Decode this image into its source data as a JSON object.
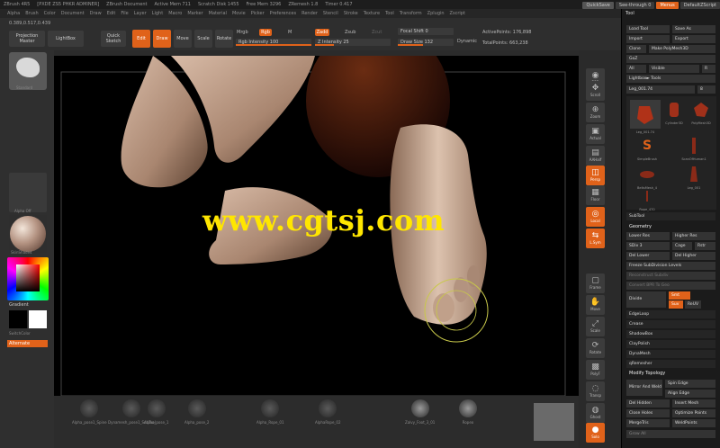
{
  "app": {
    "title_items": [
      "ZBrush 4R5",
      "[PXDE ZS5 PHKR ADMINER]",
      "ZBrush Document",
      "Active Mem 711",
      "Scratch Disk 1455",
      "Free Mem 3296",
      "ZRemesh 1.8",
      "Timer 0.417"
    ],
    "quicksave": "QuickSave",
    "see_through": "See-through",
    "see_through_value": "0",
    "menus_label": "Menus",
    "default_script": "DefaultZScript"
  },
  "menubar": {
    "items": [
      "Alpha",
      "Brush",
      "Color",
      "Document",
      "Draw",
      "Edit",
      "File",
      "Layer",
      "Light",
      "Macro",
      "Marker",
      "Material",
      "Movie",
      "Picker",
      "Preferences",
      "Render",
      "Stencil",
      "Stroke",
      "Texture",
      "Tool",
      "Transform",
      "Zplugin",
      "Zscript"
    ]
  },
  "toolbar": {
    "coords": "0.389,0.517,0.439",
    "projection_master": "Projection Master",
    "lightbox": "LightBox",
    "quick_sketch": "Quick Sketch",
    "edit": "Edit",
    "draw": "Draw",
    "move": "Move",
    "scale": "Scale",
    "rotate": "Rotate",
    "mrgb": "Mrgb",
    "rgb": "Rgb",
    "m": "M",
    "zadd": "Zadd",
    "zsub": "Zsub",
    "zcut": "Zcut",
    "rgb_intensity": "Rgb Intensity 100",
    "z_intensity": "Z Intensity 25",
    "focal_shift": "Focal Shift 0",
    "draw_size": "Draw Size 132",
    "dynamic": "Dynamic",
    "active_points": "ActivePoints: 176,898",
    "total_points": "TotalPoints: 663,238",
    "rgb_intensity_fill": 1.0,
    "z_intensity_fill": 0.25,
    "draw_size_fill": 0.45
  },
  "leftpanel": {
    "brush_label": "Standard",
    "alpha_label": "Alpha Off",
    "material_label": "SkinShade4",
    "gradient_label": "Gradient",
    "switch_color": "SwitchColor",
    "alternate": "Alternate"
  },
  "shelf": {
    "items": [
      "Alpha_pose1_Spine",
      "Dynamesh_pose1_SubTool",
      "Alpha_pose_1",
      "Alpha_pose_2",
      "Alpha_Rope_01",
      "AlphaRope_02",
      "Zalvy_Foot_3_01",
      "Ropeo"
    ]
  },
  "rightshelf": {
    "buttons": [
      "BPR",
      "Scroll",
      "Zoom",
      "Actual",
      "AAHalf",
      "Persp",
      "Floor",
      "Local",
      "L.Sym",
      "Frame",
      "Move",
      "Scale",
      "Rotate",
      "PolyF",
      "Transp",
      "Ghost",
      "Solo",
      "Xpose"
    ]
  },
  "toolpanel": {
    "title": "Tool",
    "load_tool": "Load Tool",
    "save_as": "Save As",
    "import": "Import",
    "export": "Export",
    "clone": "Clone",
    "make_polymesh": "Make PolyMesh3D",
    "goz": "GoZ",
    "all": "All",
    "visible": "Visible",
    "r": "R",
    "lightbox_tools": "Lightbox► Tools",
    "current_tool": "Leg_001.74",
    "tool_count": "8",
    "tools": [
      "Leg_001.74",
      "Cylinder3D",
      "PolyMesh3D",
      "SimpleBrush",
      "ScanOfHuman1",
      "BeltsMesh_4",
      "Leg_001",
      "Rope_470"
    ],
    "subtool": "SubTool",
    "geometry": "Geometry",
    "lower_res": "Lower Res",
    "higher_res": "Higher Res",
    "sdiv": "SDiv 3",
    "cage": "Cage",
    "rstr": "Rstr",
    "del_lower": "Del Lower",
    "del_higher": "Del Higher",
    "freeze_subdiv": "Freeze SubDivision Levels",
    "reconstruct_subdiv": "Reconstruct Subdiv",
    "convert_bpr": "Convert BPR To Geo",
    "divide": "Divide",
    "smt": "Smt",
    "suv": "Suv",
    "reuv": "ReUV",
    "edge_loop": "EdgeLoop",
    "crease": "Crease",
    "shadowbox": "ShadowBox",
    "clay_polish": "ClayPolish",
    "dynamesh": "DynaMesh",
    "qremesher": "qRemesher",
    "modify_topology": "Modify Topology",
    "mirror_and_weld": "Mirror And Weld",
    "spin_edge": "Spin Edge",
    "align_edge": "Align Edge",
    "del_hidden": "Del Hidden",
    "insert_mesh": "Insert Mesh",
    "close_holes": "Close Holes",
    "optimize_points": "Optimize Points",
    "merge_tris": "MergeTris",
    "weld_points": "WeldPoints",
    "grow_all": "Grow All"
  },
  "viewport": {
    "watermark": "www.cgtsj.com"
  },
  "colors": {
    "accent": "#e0621a",
    "watermark": "#ffe600",
    "skin": "#c9a893"
  }
}
